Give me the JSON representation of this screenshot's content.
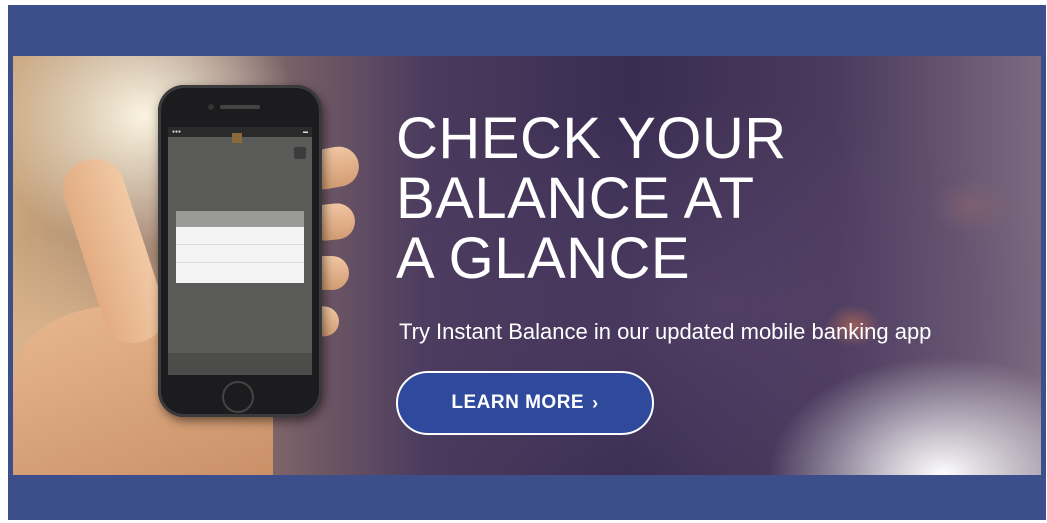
{
  "banner": {
    "headline": "CHECK YOUR\nBALANCE AT\nA GLANCE",
    "subheadline": "Try Instant Balance in our updated mobile banking app",
    "cta": {
      "label": "LEARN MORE",
      "icon": "chevron-right-icon",
      "chevron": "›"
    }
  },
  "colors": {
    "frame": "#3d4f8a",
    "cta_background": "#2f4a9c",
    "cta_border": "#ffffff",
    "text": "#ffffff"
  }
}
